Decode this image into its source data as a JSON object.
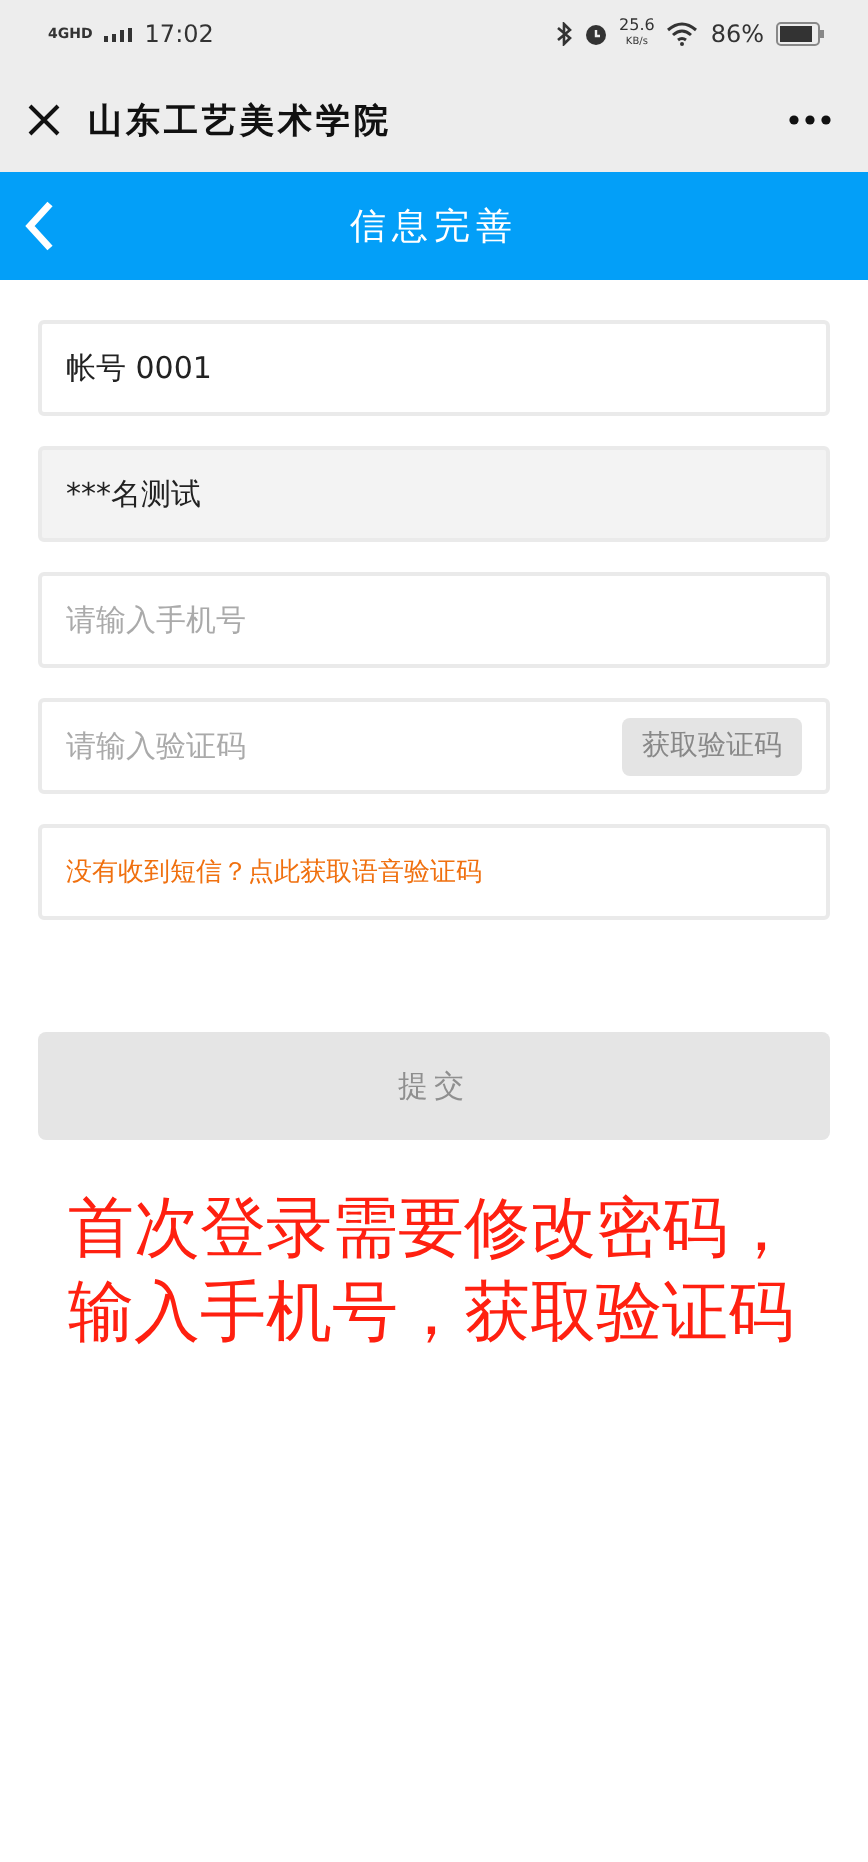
{
  "status_bar": {
    "network": "4G",
    "network_sub": "HD",
    "time": "17:02",
    "speed": "25.6",
    "speed_unit": "KB/s",
    "battery": "86%"
  },
  "browser_bar": {
    "title": "山东工艺美术学院"
  },
  "header": {
    "title": "信息完善"
  },
  "fields": [
    {
      "kind": "text",
      "value": "帐号 0001",
      "disabled": false
    },
    {
      "kind": "text",
      "value": "***名测试",
      "disabled": true
    },
    {
      "kind": "input",
      "placeholder": "请输入手机号",
      "disabled": false
    },
    {
      "kind": "code",
      "placeholder": "请输入验证码",
      "button": "获取验证码",
      "disabled": false
    },
    {
      "kind": "link",
      "value": "没有收到短信？点此获取语音验证码",
      "disabled": false
    }
  ],
  "submit": {
    "label": "提交",
    "disabled": true
  },
  "annotation_lines": [
    "首次登录需要修改密码，",
    "输入手机号，获取验证码"
  ]
}
